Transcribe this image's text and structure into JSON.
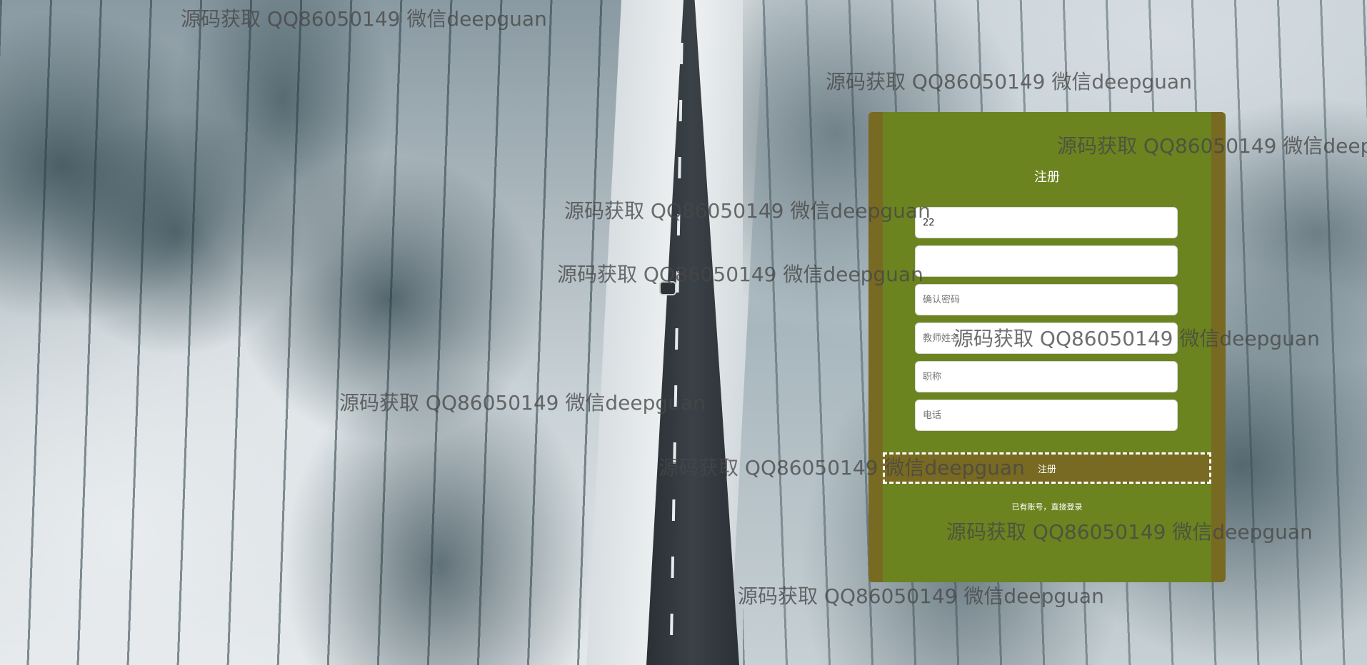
{
  "register_form": {
    "title": "注册",
    "username_value": "22",
    "password_value": "",
    "confirm_password_placeholder": "确认密码",
    "teacher_name_placeholder": "教师姓名",
    "job_title_placeholder": "职称",
    "phone_placeholder": "电话",
    "submit_label": "注册",
    "login_link": "已有账号，直接登录"
  },
  "watermark": {
    "text": "源码获取 QQ86050149 微信deepguan"
  },
  "colors": {
    "panel": "#6b8420",
    "panel_edge": "#786a22",
    "button": "#786a22"
  }
}
